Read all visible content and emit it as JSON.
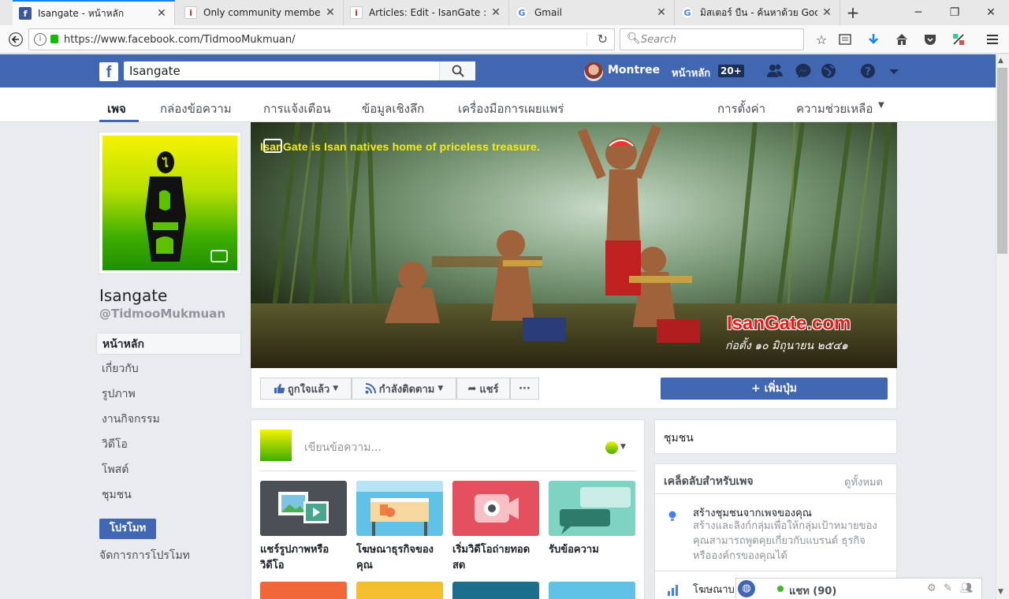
{
  "browser": {
    "tabs": [
      {
        "title": "Isangate - หน้าหลัก",
        "favicon": "facebook-favicon",
        "active": true
      },
      {
        "title": "Only community members",
        "favicon": "isangate-favicon",
        "active": false
      },
      {
        "title": "Articles: Edit - IsanGate : ประ",
        "favicon": "isangate-favicon",
        "active": false
      },
      {
        "title": "Gmail",
        "favicon": "google-favicon",
        "active": false
      },
      {
        "title": "มิสเตอร์ บีน - ค้นหาด้วย Google",
        "favicon": "google-favicon",
        "active": false
      }
    ],
    "new_tab_label": "+",
    "url": "https://www.facebook.com/TidmooMukmuan/",
    "search_placeholder": "Search"
  },
  "fb_header": {
    "logo": "f",
    "search_value": "Isangate",
    "user_name": "Montree",
    "home_label": "หน้าหลัก",
    "home_badge": "20+"
  },
  "page_nav": {
    "items": [
      "เพจ",
      "กล่องข้อความ",
      "การแจ้งเตือน",
      "ข้อมูลเชิงลึก",
      "เครื่องมือการเผยแพร่"
    ],
    "settings": "การตั้งค่า",
    "help": "ความช่วยเหลือ"
  },
  "page": {
    "name": "Isangate",
    "handle": "@TidmooMukmuan",
    "left_nav": [
      "หน้าหลัก",
      "เกี่ยวกับ",
      "รูปภาพ",
      "งานกิจกรรม",
      "วิดีโอ",
      "โพสต์",
      "ชุมชน"
    ],
    "promote_label": "โปรโมท",
    "manage_promotions": "จัดการการโปรโมท"
  },
  "cover": {
    "tagline": "IsanGate is Isan natives home of priceless treasure.",
    "brand": "IsanGate.com",
    "subtitle": "ก่อตั้ง ๑๐ มิถุนายน ๒๕๔๑"
  },
  "actions": {
    "like": "ถูกใจแล้ว",
    "follow": "กำลังติดตาม",
    "share": "แชร์",
    "more": "···",
    "add_button": "+ เพิ่มปุ่ม"
  },
  "composer": {
    "placeholder": "เขียนข้อความ...",
    "cards": [
      {
        "label": "แชร์รูปภาพหรือวิดีโอ",
        "color": "#4b4f56"
      },
      {
        "label": "โฆษณาธุรกิจของคุณ",
        "color": "#60c2e6"
      },
      {
        "label": "เริ่มวิดีโอถ่ายทอดสด",
        "color": "#e5505f"
      },
      {
        "label": "รับข้อความ",
        "color": "#7fd3c2"
      }
    ],
    "row2_colors": [
      "#f0683a",
      "#f4bf2e",
      "#1b6f8d",
      "#60c2e6"
    ]
  },
  "right": {
    "community": "ชุมชน",
    "tips_title": "เคล็ดลับสำหรับเพจ",
    "see_all": "ดูทั้งหมด",
    "tip1_title": "สร้างชุมชนจากเพจของคุณ",
    "tip1_desc": "สร้างและลิงก์กลุ่มเพื่อให้กลุ่มเป้าหมายของคุณสามารถพูดคุยเกี่ยวกับแบรนด์ ธุรกิจ หรือองค์กรของคุณได้",
    "tip2_title": "โฆษณาบ"
  },
  "chat": {
    "label": "แชท (90)"
  }
}
